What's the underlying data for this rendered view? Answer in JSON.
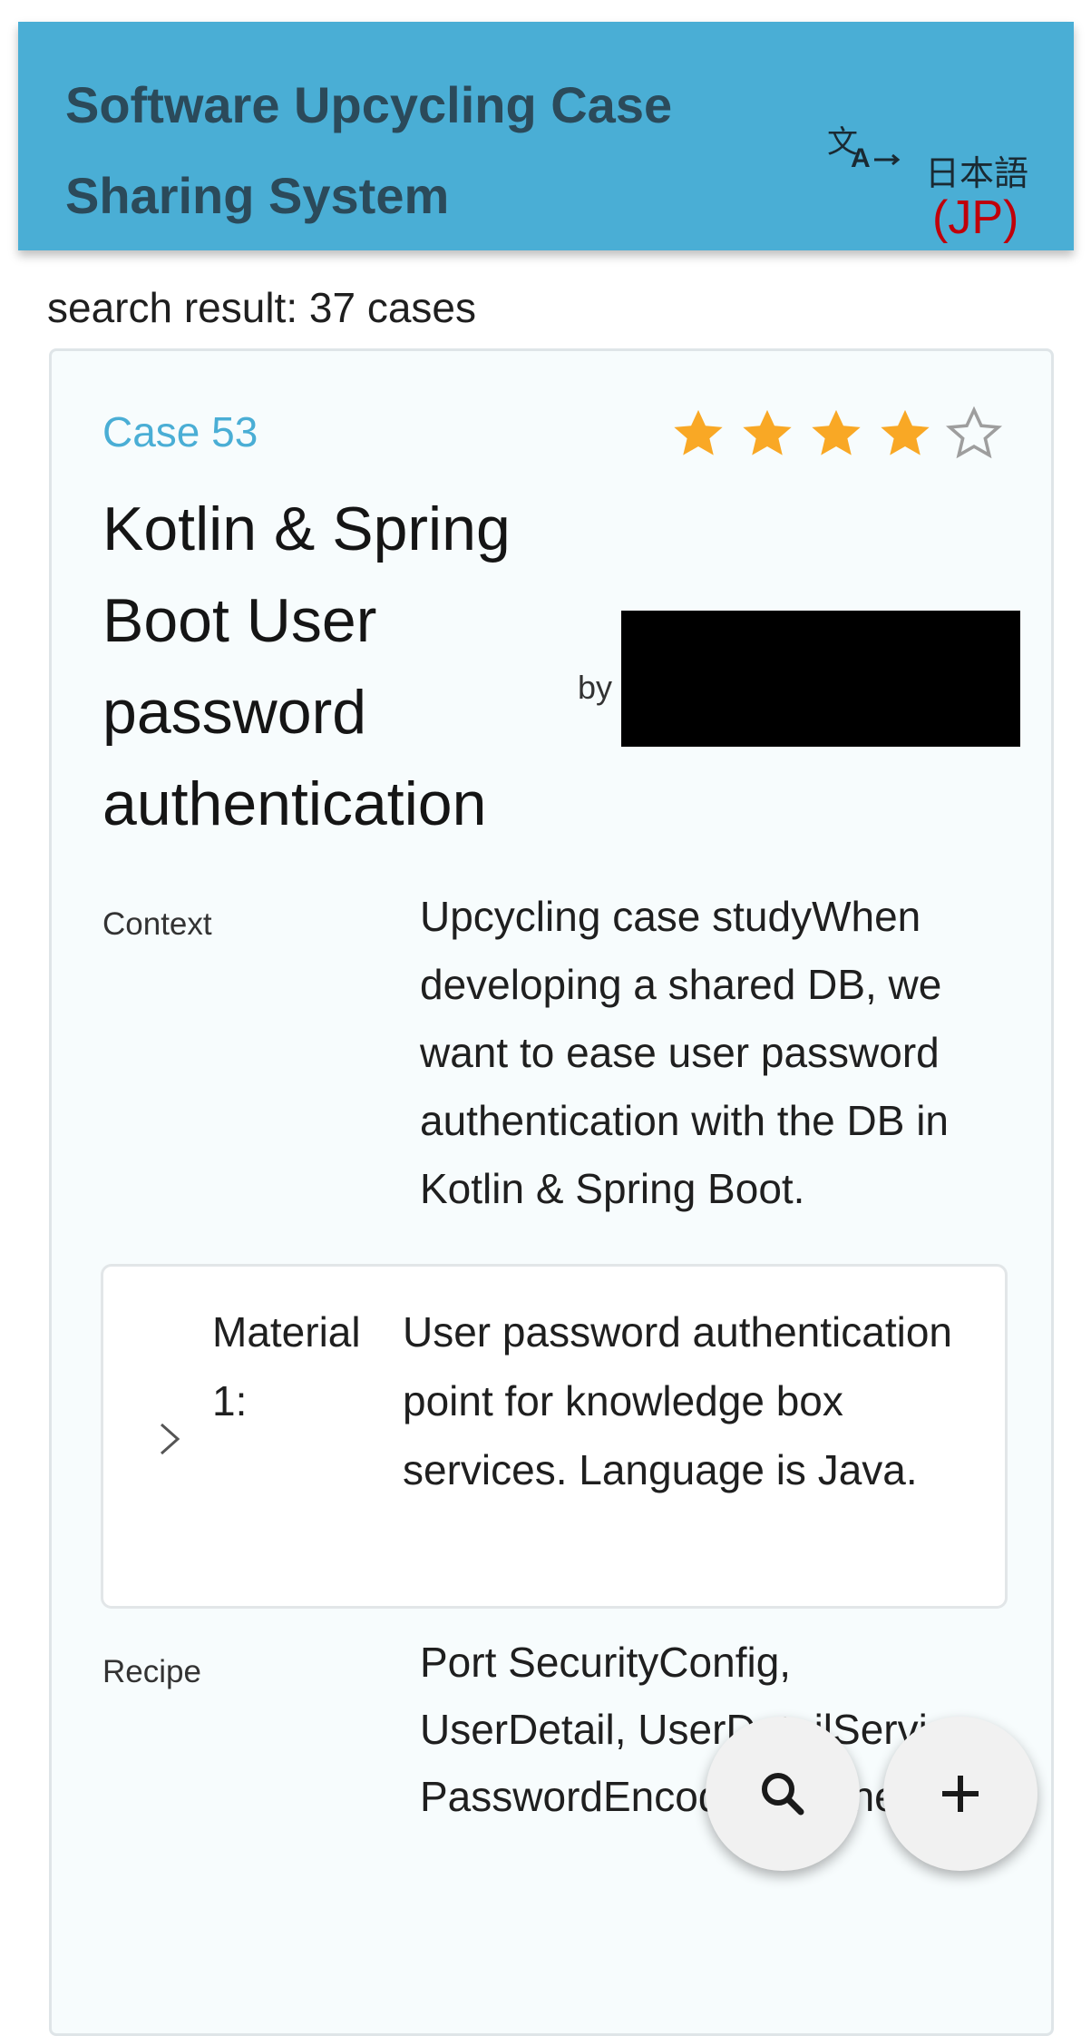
{
  "app_bar": {
    "title": "Software Upcycling Case Sharing System",
    "language_label": "日本語",
    "language_code": "(JP)",
    "color": "#4aaed5"
  },
  "search": {
    "result_text": "search result: 37 cases"
  },
  "case": {
    "id_label": "Case 53",
    "rating": 4,
    "rating_max": 5,
    "title": "Kotlin & Spring Boot User password authentication",
    "by_label": "by",
    "context_label": "Context",
    "context_text": "Upcycling case studyWhen developing a shared DB, we want to ease user password authentication with the DB in Kotlin & Spring Boot.",
    "material_label": "Material 1:",
    "material_text": "User password authentication point for knowledge box services. Language is Java.",
    "recipe_label": "Recipe",
    "recipe_text": "Port SecurityConfig, UserDetail, UserDetailService, PasswordEncoder to a new"
  },
  "icons": {
    "translate": "translate-icon",
    "star_filled": "star-filled-icon",
    "star_empty": "star-outline-icon",
    "chevron": "chevron-right-icon",
    "search": "search-icon",
    "add": "add-icon"
  },
  "colors": {
    "accent": "#4aaed5",
    "star": "#f9a825",
    "lang_code": "#c0000a"
  }
}
